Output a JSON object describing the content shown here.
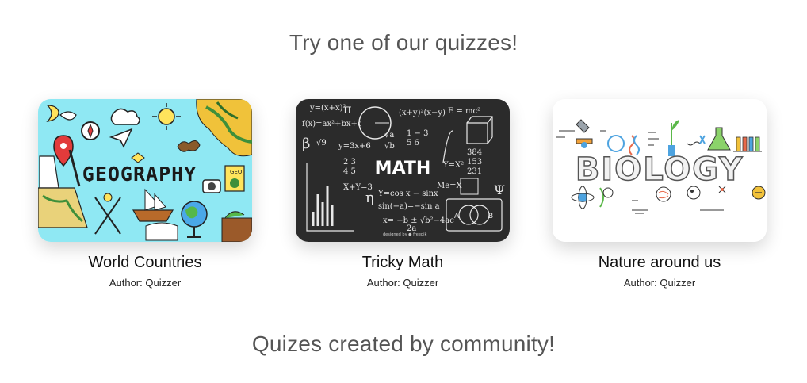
{
  "featured": {
    "title": "Try one of our quizzes!",
    "quizzes": [
      {
        "name": "World Countries",
        "author_label": "Author: Quizzer",
        "image_text": "GEOGRAPHY",
        "image_icon": "geography-illustration"
      },
      {
        "name": "Tricky Math",
        "author_label": "Author: Quizzer",
        "image_text": "MATH",
        "image_icon": "math-chalkboard-illustration",
        "image_credit": "designed by ● freepik"
      },
      {
        "name": "Nature around us",
        "author_label": "Author: Quizzer",
        "image_text": "BIOLOGY",
        "image_icon": "biology-illustration"
      }
    ]
  },
  "community": {
    "title": "Quizes created by community!"
  },
  "colors": {
    "heading": "#555555",
    "geography_bg": "#8fe8f3",
    "math_bg": "#2b2b2b",
    "biology_bg": "#ffffff"
  }
}
